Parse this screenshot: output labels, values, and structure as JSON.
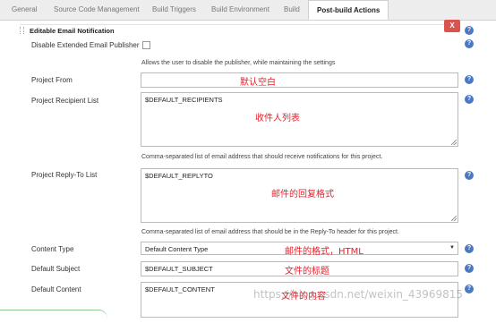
{
  "tabs": [
    {
      "label": "General"
    },
    {
      "label": "Source Code Management"
    },
    {
      "label": "Build Triggers"
    },
    {
      "label": "Build Environment"
    },
    {
      "label": "Build"
    },
    {
      "label": "Post-build Actions",
      "active": true
    }
  ],
  "section": {
    "title": "Editable Email Notification",
    "delete_label": "X"
  },
  "fields": {
    "disable_publisher": {
      "label": "Disable Extended Email Publisher",
      "checked": false,
      "description": "Allows the user to disable the publisher, while maintaining the settings"
    },
    "project_from": {
      "label": "Project From",
      "value": "",
      "annotation": "默认空白"
    },
    "recipient_list": {
      "label": "Project Recipient List",
      "value": "$DEFAULT_RECIPIENTS",
      "annotation": "收件人列表",
      "description": "Comma-separated list of email address that should receive notifications for this project."
    },
    "reply_to": {
      "label": "Project Reply-To List",
      "value": "$DEFAULT_REPLYTO",
      "annotation": "邮件的回复格式",
      "description": "Comma-separated list of email address that should be in the Reply-To header for this project."
    },
    "content_type": {
      "label": "Content Type",
      "value": "Default Content Type",
      "annotation": "邮件的格式，HTML"
    },
    "default_subject": {
      "label": "Default Subject",
      "value": "$DEFAULT_SUBJECT",
      "annotation": "文件的标题"
    },
    "default_content": {
      "label": "Default Content",
      "value": "$DEFAULT_CONTENT",
      "annotation": "文件的内容"
    }
  },
  "help_icon": "question-help-icon",
  "watermark": "https://blog.csdn.net/weixin_43969815",
  "colors": {
    "delete": "#d9534f",
    "help": "#4a78c2",
    "annotation": "#e8202a"
  }
}
